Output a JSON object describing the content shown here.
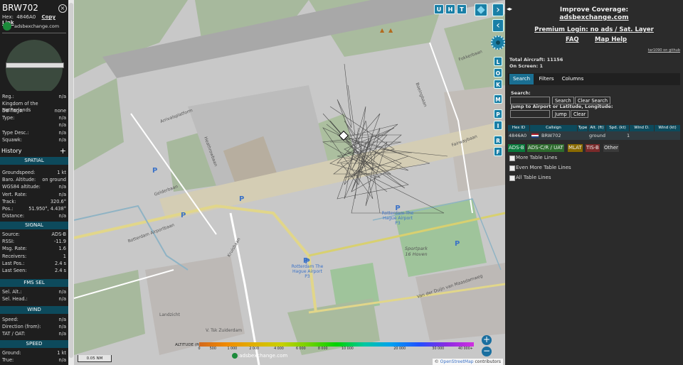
{
  "left_panel": {
    "callsign": "BRW702",
    "hex_label": "Hex:",
    "hex_value": "4846A0",
    "copy_link": "Copy Link",
    "site_name": "adsbexchange.com",
    "reg_label": "Reg.:",
    "reg_value": "n/a",
    "country": "Kingdom of the Netherlands",
    "dbflags_label": "DB flags:",
    "dbflags_value": "none",
    "type_label": "Type:",
    "type_value": "n/a",
    "blank_value": "n/a",
    "typedesc_label": "Type Desc.:",
    "typedesc_value": "n/a",
    "squawk_label": "Squawk:",
    "squawk_value": "n/a",
    "history_label": "History",
    "sections": {
      "spatial": "SPATIAL",
      "signal": "SIGNAL",
      "fms": "FMS SEL",
      "wind": "WIND",
      "speed": "SPEED"
    },
    "spatial": [
      {
        "k": "Groundspeed:",
        "v": "1 kt"
      },
      {
        "k": "Baro. Altitude:",
        "v": "on ground"
      },
      {
        "k": "WGS84 altitude:",
        "v": "n/a"
      },
      {
        "k": "Vert. Rate:",
        "v": "n/a"
      },
      {
        "k": "Track:",
        "v": "320.6°"
      },
      {
        "k": "Pos.:",
        "v": "51.950°, 4.438°"
      },
      {
        "k": "Distance:",
        "v": "n/a"
      }
    ],
    "signal": [
      {
        "k": "Source:",
        "v": "ADS-B"
      },
      {
        "k": "RSSI:",
        "v": "-11.9"
      },
      {
        "k": "Msg. Rate:",
        "v": "1.6"
      },
      {
        "k": "Receivers:",
        "v": "1"
      },
      {
        "k": "Last Pos.:",
        "v": "2.4 s"
      },
      {
        "k": "Last Seen:",
        "v": "2.4 s"
      }
    ],
    "fms": [
      {
        "k": "Sel. Alt.:",
        "v": "n/a"
      },
      {
        "k": "Sel. Head.:",
        "v": "n/a"
      }
    ],
    "wind": [
      {
        "k": "Speed:",
        "v": "n/a"
      },
      {
        "k": "Direction (from):",
        "v": "n/a"
      },
      {
        "k": "TAT / OAT:",
        "v": "n/a"
      }
    ],
    "speed": [
      {
        "k": "Ground:",
        "v": "1 kt"
      },
      {
        "k": "True:",
        "v": "n/a"
      }
    ]
  },
  "map": {
    "top_buttons": [
      "U",
      "H",
      "T"
    ],
    "side_buttons": [
      "L",
      "O",
      "K",
      "M",
      "P",
      "I",
      "R",
      "F"
    ],
    "scale": "0.05 NM",
    "altitude_label": "ALTITUDE (ft)",
    "altitude_ticks": [
      "0",
      "500",
      "1 000",
      "2 000",
      "4 000",
      "6 000",
      "8 000",
      "10 000",
      "20 000",
      "30 000",
      "40 000+"
    ],
    "watermark": "adsbexchange.com",
    "attribution_prefix": "©",
    "attribution_link": "OpenStreetMap",
    "attribution_suffix": "contributors",
    "labels": {
      "platform": "Arrivalsplatform",
      "rotterdam_airportbaan": "Rotterdam Airportbaan",
      "kruisbaan": "Kruisbaan",
      "airport1": "Rotterdam The Hague Airport",
      "airport1_code": "P3",
      "airport2": "Rotterdam The Hague Airport",
      "airport2_code": "P3",
      "sportpark": "Sportpark 16 Hoven",
      "vandeduijn": "Van der Duijn van Maasdamweg",
      "fairwaybaan": "Fairwaybaan",
      "landzicht": "Landzicht",
      "zuiderdam": "V. Tsk Zuiderdam",
      "gelderbaan": "Gelderbaan",
      "heathrowbaan": "Heathrowbaan",
      "boeingbaan": "Boeingbaan",
      "fokkerbaan": "Fokkerbaan"
    }
  },
  "right_panel": {
    "improve_title": "Improve Coverage:",
    "improve_link": "adsbexchange.com",
    "premium": "Premium Login: no ads / Sat. Layer",
    "faq": "FAQ",
    "map_help": "Map Help",
    "version": "tar1090 on github",
    "total_label": "Total Aircraft:",
    "total_value": "11156",
    "onscreen_label": "On Screen:",
    "onscreen_value": "1",
    "tabs": [
      "Search",
      "Filters",
      "Columns"
    ],
    "search_label": "Search:",
    "search_button": "Search",
    "clear_search_button": "Clear Search",
    "jump_label": "Jump to Airport or Latitude, Longitude:",
    "jump_button": "Jump",
    "clear_button": "Clear",
    "table_headers": [
      "Hex ID",
      "Callsign",
      "Type",
      "Alt. (ft)",
      "Spd. (kt)",
      "Wind D.",
      "Wind (kt)"
    ],
    "row": {
      "hex": "4846A0",
      "callsign": "BRW702",
      "type": "",
      "alt": "ground",
      "spd": "1",
      "windd": "",
      "wind": ""
    },
    "chips": [
      "ADS-B",
      "ADS-C/R / UAT",
      "MLAT",
      "TIS-B",
      "Other"
    ],
    "chip_colors": [
      "#0a7a3c",
      "#2e6b2e",
      "#8a6a00",
      "#7a2a2a",
      "#3a3a3a"
    ],
    "checkbox_labels": [
      "More Table Lines",
      "Even More Table Lines",
      "All Table Lines"
    ]
  }
}
